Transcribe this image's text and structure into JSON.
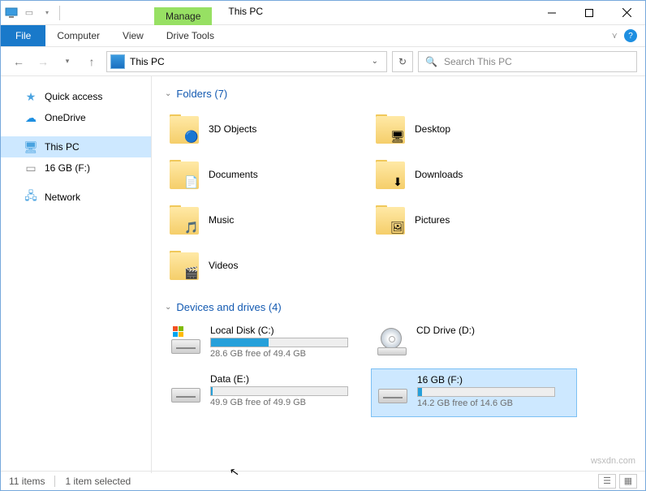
{
  "title": "This PC",
  "ribbon": {
    "manage": "Manage",
    "drive_tools": "Drive Tools",
    "file": "File",
    "computer": "Computer",
    "view": "View"
  },
  "nav": {
    "location": "This PC",
    "search_placeholder": "Search This PC"
  },
  "sidebar": {
    "items": [
      {
        "label": "Quick access",
        "icon": "star",
        "color": "#4aa3e0"
      },
      {
        "label": "OneDrive",
        "icon": "cloud",
        "color": "#1e8fe1"
      },
      {
        "label": "This PC",
        "icon": "pc",
        "color": "#4aa3e0",
        "selected": true
      },
      {
        "label": "16 GB (F:)",
        "icon": "drive",
        "color": "#888"
      },
      {
        "label": "Network",
        "icon": "network",
        "color": "#4aa3e0"
      }
    ]
  },
  "groups": {
    "folders": {
      "title": "Folders (7)",
      "items": [
        {
          "label": "3D Objects",
          "badge": "🔵"
        },
        {
          "label": "Desktop",
          "badge": "🖥"
        },
        {
          "label": "Documents",
          "badge": "📄"
        },
        {
          "label": "Downloads",
          "badge": "⬇"
        },
        {
          "label": "Music",
          "badge": "🎵"
        },
        {
          "label": "Pictures",
          "badge": "🖼"
        },
        {
          "label": "Videos",
          "badge": "🎬"
        }
      ]
    },
    "drives": {
      "title": "Devices and drives (4)",
      "items": [
        {
          "name": "Local Disk (C:)",
          "free": "28.6 GB free of 49.4 GB",
          "pct": 42,
          "logo": "win",
          "bar": true
        },
        {
          "name": "CD Drive (D:)",
          "free": "",
          "pct": 0,
          "logo": "disc",
          "bar": false
        },
        {
          "name": "Data (E:)",
          "free": "49.9 GB free of 49.9 GB",
          "pct": 1,
          "logo": "",
          "bar": true
        },
        {
          "name": "16 GB (F:)",
          "free": "14.2 GB free of 14.6 GB",
          "pct": 3,
          "logo": "",
          "bar": true,
          "selected": true
        }
      ]
    }
  },
  "status": {
    "count": "11 items",
    "selected": "1 item selected"
  },
  "watermark": "wsxdn.com"
}
